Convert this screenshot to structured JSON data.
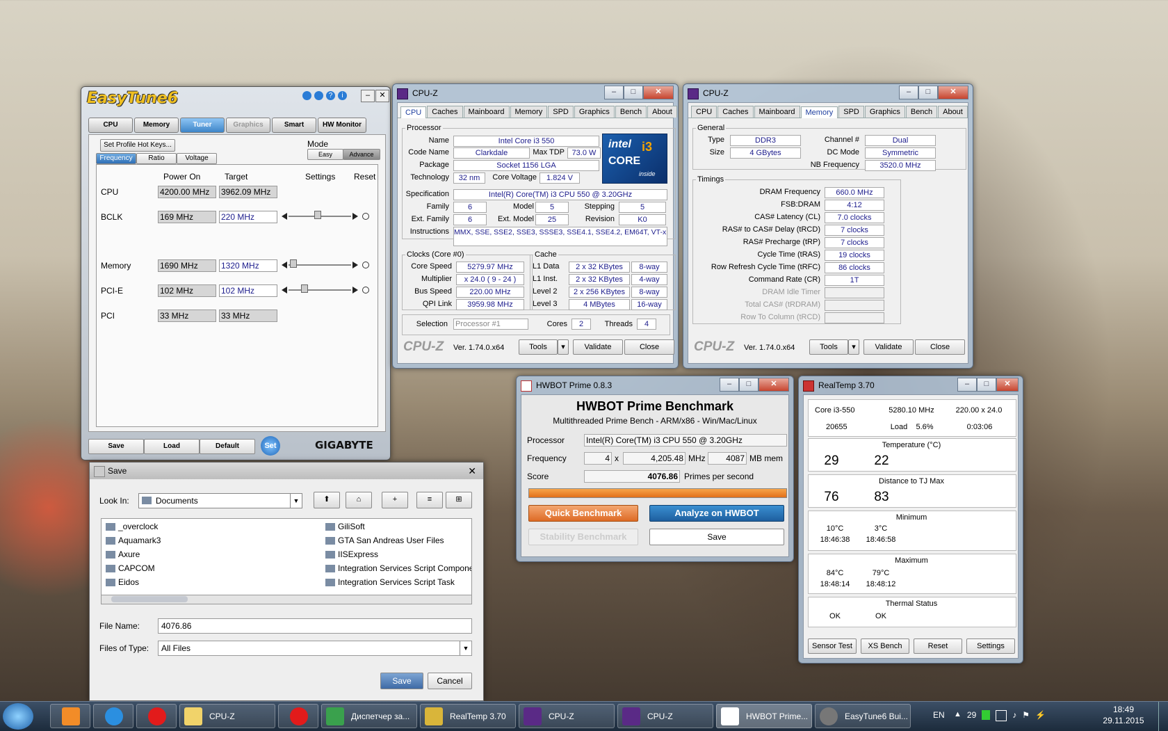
{
  "easytune": {
    "logo": "EasyTune6",
    "tabs": [
      "CPU",
      "Memory",
      "Tuner",
      "Graphics",
      "Smart",
      "HW Monitor"
    ],
    "hotkeys_button": "Set Profile Hot Keys...",
    "mode_label": "Mode",
    "mode_easy": "Easy",
    "mode_advance": "Advance",
    "subtabs": [
      "Frequency",
      "Ratio",
      "Voltage"
    ],
    "col_power_on": "Power On",
    "col_target": "Target",
    "col_settings": "Settings",
    "col_reset": "Reset",
    "rows": [
      {
        "name": "CPU",
        "power_on": "4200.00 MHz",
        "target": "3962.09 MHz"
      },
      {
        "name": "BCLK",
        "power_on": "169 MHz",
        "target": "220 MHz"
      },
      {
        "name": "Memory",
        "power_on": "1690 MHz",
        "target": "1320 MHz"
      },
      {
        "name": "PCI-E",
        "power_on": "102 MHz",
        "target": "102 MHz"
      },
      {
        "name": "PCI",
        "power_on": "33 MHz",
        "target": "33 MHz"
      }
    ],
    "btn_save": "Save",
    "btn_load": "Load",
    "btn_default": "Default",
    "btn_set": "Set",
    "brand": "GIGABYTE"
  },
  "cpuz1": {
    "title": "CPU-Z",
    "tabs": [
      "CPU",
      "Caches",
      "Mainboard",
      "Memory",
      "SPD",
      "Graphics",
      "Bench",
      "About"
    ],
    "processor_legend": "Processor",
    "name_lbl": "Name",
    "name": "Intel Core i3 550",
    "codename_lbl": "Code Name",
    "codename": "Clarkdale",
    "maxtdp_lbl": "Max TDP",
    "maxtdp": "73.0 W",
    "package_lbl": "Package",
    "package": "Socket 1156 LGA",
    "tech_lbl": "Technology",
    "tech": "32 nm",
    "corevolt_lbl": "Core Voltage",
    "corevolt": "1.824 V",
    "spec_lbl": "Specification",
    "spec": "Intel(R) Core(TM) i3 CPU      550  @ 3.20GHz",
    "family_lbl": "Family",
    "family": "6",
    "model_lbl": "Model",
    "model": "5",
    "stepping_lbl": "Stepping",
    "stepping": "5",
    "extfamily_lbl": "Ext. Family",
    "extfamily": "6",
    "extmodel_lbl": "Ext. Model",
    "extmodel": "25",
    "revision_lbl": "Revision",
    "revision": "K0",
    "instr_lbl": "Instructions",
    "instr": "MMX, SSE, SSE2, SSE3, SSSE3, SSE4.1, SSE4.2, EM64T, VT-x",
    "clocks_legend": "Clocks (Core #0)",
    "corespeed_lbl": "Core Speed",
    "corespeed": "5279.97 MHz",
    "mult_lbl": "Multiplier",
    "mult": "x 24.0  ( 9 - 24 )",
    "bus_lbl": "Bus Speed",
    "bus": "220.00 MHz",
    "qpi_lbl": "QPI Link",
    "qpi": "3959.98 MHz",
    "cache_legend": "Cache",
    "l1d_lbl": "L1 Data",
    "l1d": "2 x 32 KBytes",
    "l1d_way": "8-way",
    "l1i_lbl": "L1 Inst.",
    "l1i": "2 x 32 KBytes",
    "l1i_way": "4-way",
    "l2_lbl": "Level 2",
    "l2": "2 x 256 KBytes",
    "l2_way": "8-way",
    "l3_lbl": "Level 3",
    "l3": "4 MBytes",
    "l3_way": "16-way",
    "selection_lbl": "Selection",
    "selection": "Processor #1",
    "cores_lbl": "Cores",
    "cores": "2",
    "threads_lbl": "Threads",
    "threads": "4",
    "brand": "CPU-Z",
    "ver": "Ver. 1.74.0.x64",
    "tools": "Tools",
    "validate": "Validate",
    "close": "Close",
    "intel_logo1": "intel",
    "intel_logo2": "CORE",
    "intel_logo3": "i3",
    "intel_logo4": "inside"
  },
  "cpuz2": {
    "title": "CPU-Z",
    "tabs": [
      "CPU",
      "Caches",
      "Mainboard",
      "Memory",
      "SPD",
      "Graphics",
      "Bench",
      "About"
    ],
    "general_legend": "General",
    "type_lbl": "Type",
    "type": "DDR3",
    "channel_lbl": "Channel #",
    "channel": "Dual",
    "size_lbl": "Size",
    "size": "4 GBytes",
    "dcmode_lbl": "DC Mode",
    "dcmode": "Symmetric",
    "nbfreq_lbl": "NB Frequency",
    "nbfreq": "3520.0 MHz",
    "timings_legend": "Timings",
    "timings": [
      {
        "label": "DRAM Frequency",
        "value": "660.0 MHz"
      },
      {
        "label": "FSB:DRAM",
        "value": "4:12"
      },
      {
        "label": "CAS# Latency (CL)",
        "value": "7.0 clocks"
      },
      {
        "label": "RAS# to CAS# Delay (tRCD)",
        "value": "7 clocks"
      },
      {
        "label": "RAS# Precharge (tRP)",
        "value": "7 clocks"
      },
      {
        "label": "Cycle Time (tRAS)",
        "value": "19 clocks"
      },
      {
        "label": "Row Refresh Cycle Time (tRFC)",
        "value": "86 clocks"
      },
      {
        "label": "Command Rate (CR)",
        "value": "1T"
      },
      {
        "label": "DRAM Idle Timer",
        "value": ""
      },
      {
        "label": "Total CAS# (tRDRAM)",
        "value": ""
      },
      {
        "label": "Row To Column (tRCD)",
        "value": ""
      }
    ],
    "brand": "CPU-Z",
    "ver": "Ver. 1.74.0.x64",
    "tools": "Tools",
    "validate": "Validate",
    "close": "Close"
  },
  "hwbot": {
    "title": "HWBOT Prime 0.8.3",
    "heading": "HWBOT Prime Benchmark",
    "subheading": "Multithreaded Prime Bench - ARM/x86 - Win/Mac/Linux",
    "processor_lbl": "Processor",
    "processor": "Intel(R) Core(TM) i3 CPU       550  @ 3.20GHz",
    "frequency_lbl": "Frequency",
    "threads": "4",
    "x": "x",
    "freq": "4,205.48",
    "mhz": "MHz",
    "mem": "4087",
    "mbmem": "MB mem",
    "score_lbl": "Score",
    "score": "4076.86",
    "score_unit": "Primes per second",
    "progress": 1.0,
    "quick": "Quick Benchmark",
    "analyze": "Analyze on HWBOT",
    "stability": "Stability Benchmark",
    "save": "Save"
  },
  "realtemp": {
    "title": "RealTemp 3.70",
    "cpu": "Core i3-550",
    "freq": "5280.10 MHz",
    "mult": "220.00 x 24.0",
    "count": "20655",
    "load_lbl": "Load",
    "load": "5.6%",
    "time": "0:03:06",
    "temp_title": "Temperature (°C)",
    "t1": "29",
    "t2": "22",
    "dist_title": "Distance to TJ Max",
    "d1": "76",
    "d2": "83",
    "min_title": "Minimum",
    "min1": "10°C",
    "min2": "3°C",
    "min1t": "18:46:38",
    "min2t": "18:46:58",
    "max_title": "Maximum",
    "max1": "84°C",
    "max2": "79°C",
    "max1t": "18:48:14",
    "max2t": "18:48:12",
    "thermal_title": "Thermal Status",
    "th1": "OK",
    "th2": "OK",
    "btn_sensor": "Sensor Test",
    "btn_xs": "XS Bench",
    "btn_reset": "Reset",
    "btn_settings": "Settings"
  },
  "savedlg": {
    "title": "Save",
    "lookin_lbl": "Look In:",
    "lookin": "Documents",
    "files_left": [
      "_overclock",
      "Aquamark3",
      "Axure",
      "CAPCOM",
      "Eidos"
    ],
    "files_right": [
      "GiliSoft",
      "GTA San Andreas User Files",
      "IISExpress",
      "Integration Services Script Component",
      "Integration Services Script Task"
    ],
    "filename_lbl": "File Name:",
    "filename": "4076.86",
    "filetype_lbl": "Files of Type:",
    "filetype": "All Files",
    "btn_save": "Save",
    "btn_cancel": "Cancel"
  },
  "taskbar": {
    "items": [
      "",
      "",
      "",
      "",
      "CPU-Z",
      "",
      "Диспетчер за...",
      "RealTemp 3.70",
      "CPU-Z",
      "CPU-Z",
      "HWBOT Prime...",
      "EasyTune6 Bui..."
    ],
    "lang": "EN",
    "temp": "29",
    "time": "18:49",
    "date": "29.11.2015"
  }
}
